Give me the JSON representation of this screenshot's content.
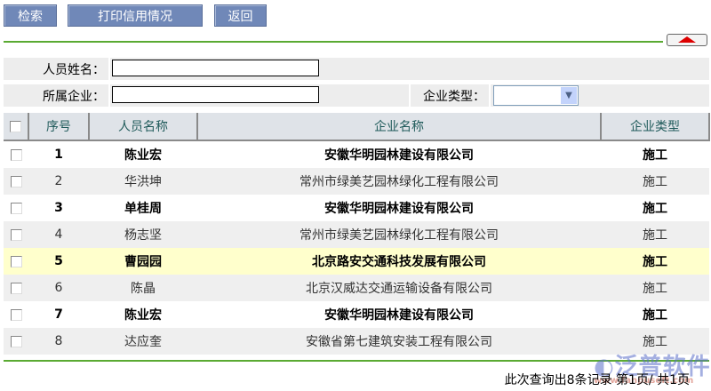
{
  "toolbar": {
    "search": "检索",
    "print": "打印信用情况",
    "back": "返回"
  },
  "form": {
    "name_label": "人员姓名：",
    "name_value": "",
    "company_label": "所属企业：",
    "company_value": "",
    "type_label": "企业类型：",
    "type_value": ""
  },
  "table": {
    "headers": [
      "序号",
      "人员名称",
      "企业名称",
      "企业类型"
    ],
    "rows": [
      {
        "no": "1",
        "name": "陈业宏",
        "company": "安徽华明园林建设有限公司",
        "type": "施工"
      },
      {
        "no": "2",
        "name": "华洪坤",
        "company": "常州市绿美艺园林绿化工程有限公司",
        "type": "施工"
      },
      {
        "no": "3",
        "name": "单桂周",
        "company": "安徽华明园林建设有限公司",
        "type": "施工"
      },
      {
        "no": "4",
        "name": "杨志坚",
        "company": "常州市绿美艺园林绿化工程有限公司",
        "type": "施工"
      },
      {
        "no": "5",
        "name": "曹园园",
        "company": "北京路安交通科技发展有限公司",
        "type": "施工"
      },
      {
        "no": "6",
        "name": "陈晶",
        "company": "北京汉威达交通运输设备有限公司",
        "type": "施工"
      },
      {
        "no": "7",
        "name": "陈业宏",
        "company": "安徽华明园林建设有限公司",
        "type": "施工"
      },
      {
        "no": "8",
        "name": "达应奎",
        "company": "安徽省第七建筑安装工程有限公司",
        "type": "施工"
      }
    ]
  },
  "footer": "此次查询出8条记录 第1页/ 共1页",
  "watermark": {
    "name": "泛普软件",
    "url": "www.fanpusoft.com"
  }
}
